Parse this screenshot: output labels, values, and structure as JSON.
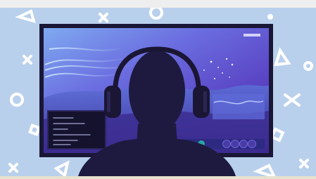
{
  "scene": {
    "subject": "person-with-headphones-at-monitor",
    "colors": {
      "background": "#b9d0ec",
      "monitor_frame": "#1a1736",
      "silhouette": "#1e1a3f",
      "screen_top": "#6b6ee0",
      "screen_bottom": "#5b3db8",
      "accent_teal": "#2aa6a4",
      "shape_white": "#ffffff"
    },
    "decor_shapes": [
      "triangle",
      "cross",
      "circle",
      "square",
      "dot"
    ],
    "hud": {
      "bottom_bar_orbs": 4,
      "window_text_lines": 6
    }
  }
}
